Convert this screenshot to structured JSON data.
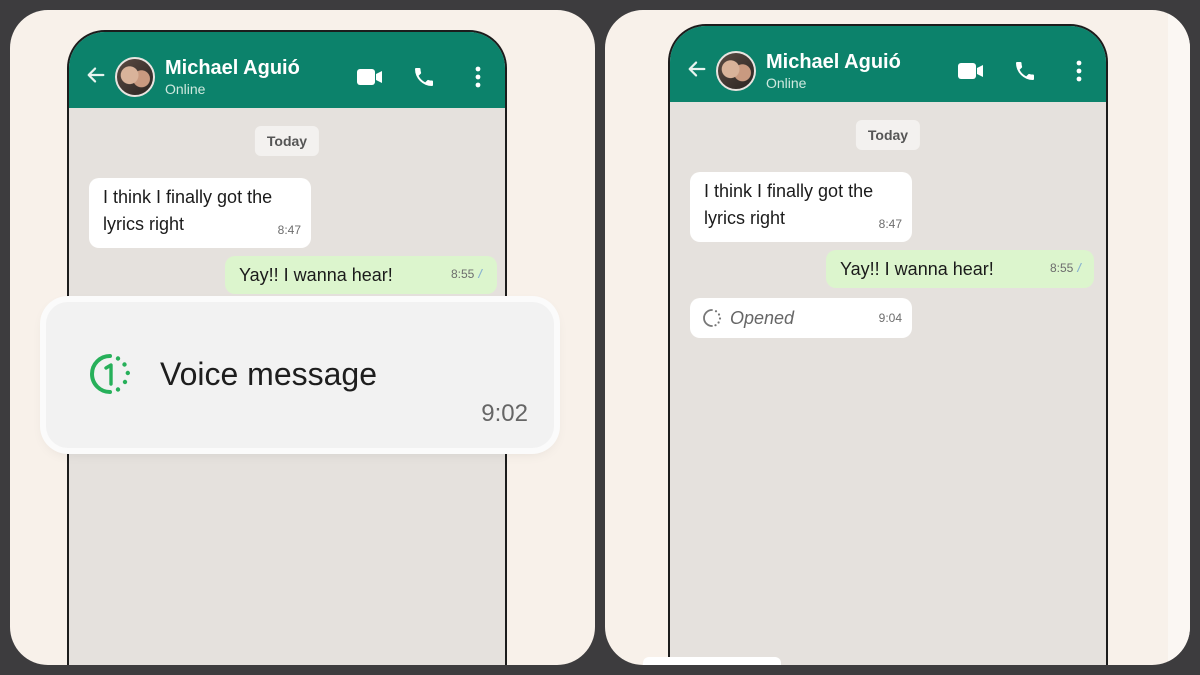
{
  "panels": [
    {
      "header": {
        "back_icon": "arrow-left-icon",
        "contact_name": "Michael Aguió",
        "status": "Online",
        "actions": [
          "video-call-icon",
          "phone-icon",
          "more-vertical-icon"
        ]
      },
      "chat": {
        "date_chip": "Today",
        "messages": [
          {
            "direction": "incoming",
            "text": "I think I finally got the lyrics right",
            "time": "8:47"
          },
          {
            "direction": "outgoing",
            "text": "Yay!! I wanna hear!",
            "time": "8:55",
            "status": "read"
          }
        ]
      },
      "popup": {
        "icon": "view-once-icon",
        "label": "Voice message",
        "time": "9:02"
      }
    },
    {
      "header": {
        "back_icon": "arrow-left-icon",
        "contact_name": "Michael Aguió",
        "status": "Online",
        "actions": [
          "video-call-icon",
          "phone-icon",
          "more-vertical-icon"
        ]
      },
      "chat": {
        "date_chip": "Today",
        "messages": [
          {
            "direction": "incoming",
            "text": "I think I finally got the lyrics right",
            "time": "8:47"
          },
          {
            "direction": "outgoing",
            "text": "Yay!! I wanna hear!",
            "time": "8:55",
            "status": "read"
          },
          {
            "direction": "incoming",
            "text": "Opened",
            "time": "9:04",
            "icon": "view-once-opened-icon"
          }
        ]
      }
    }
  ],
  "colors": {
    "header_green": "#0c826b",
    "outgoing_bubble": "#dcf5cd",
    "chat_bg": "#e5e1dd",
    "card_bg": "#f8f1ea",
    "view_once_green": "#27b05a"
  },
  "ticks_glyph": "//"
}
